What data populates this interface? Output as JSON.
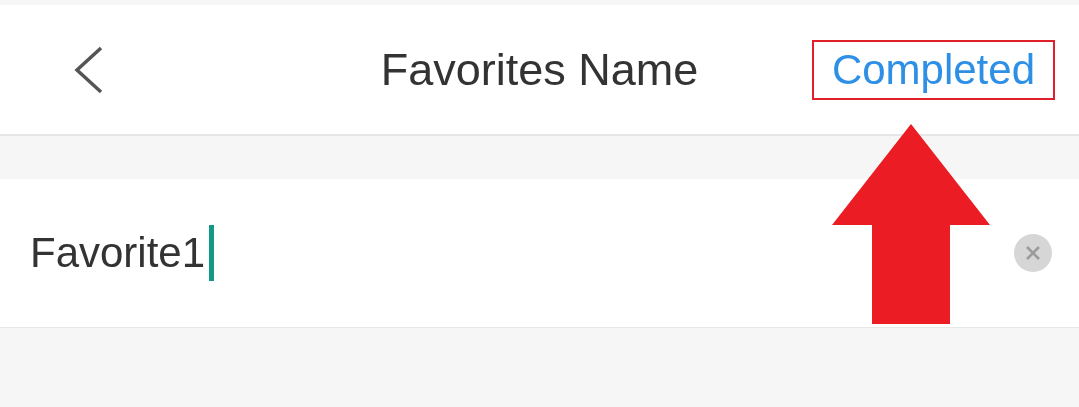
{
  "header": {
    "title": "Favorites Name",
    "action": {
      "label": "Completed",
      "highlighted": true
    }
  },
  "input": {
    "value": "Favorite1",
    "focused": true
  },
  "annotations": [
    {
      "kind": "arrow"
    }
  ]
}
